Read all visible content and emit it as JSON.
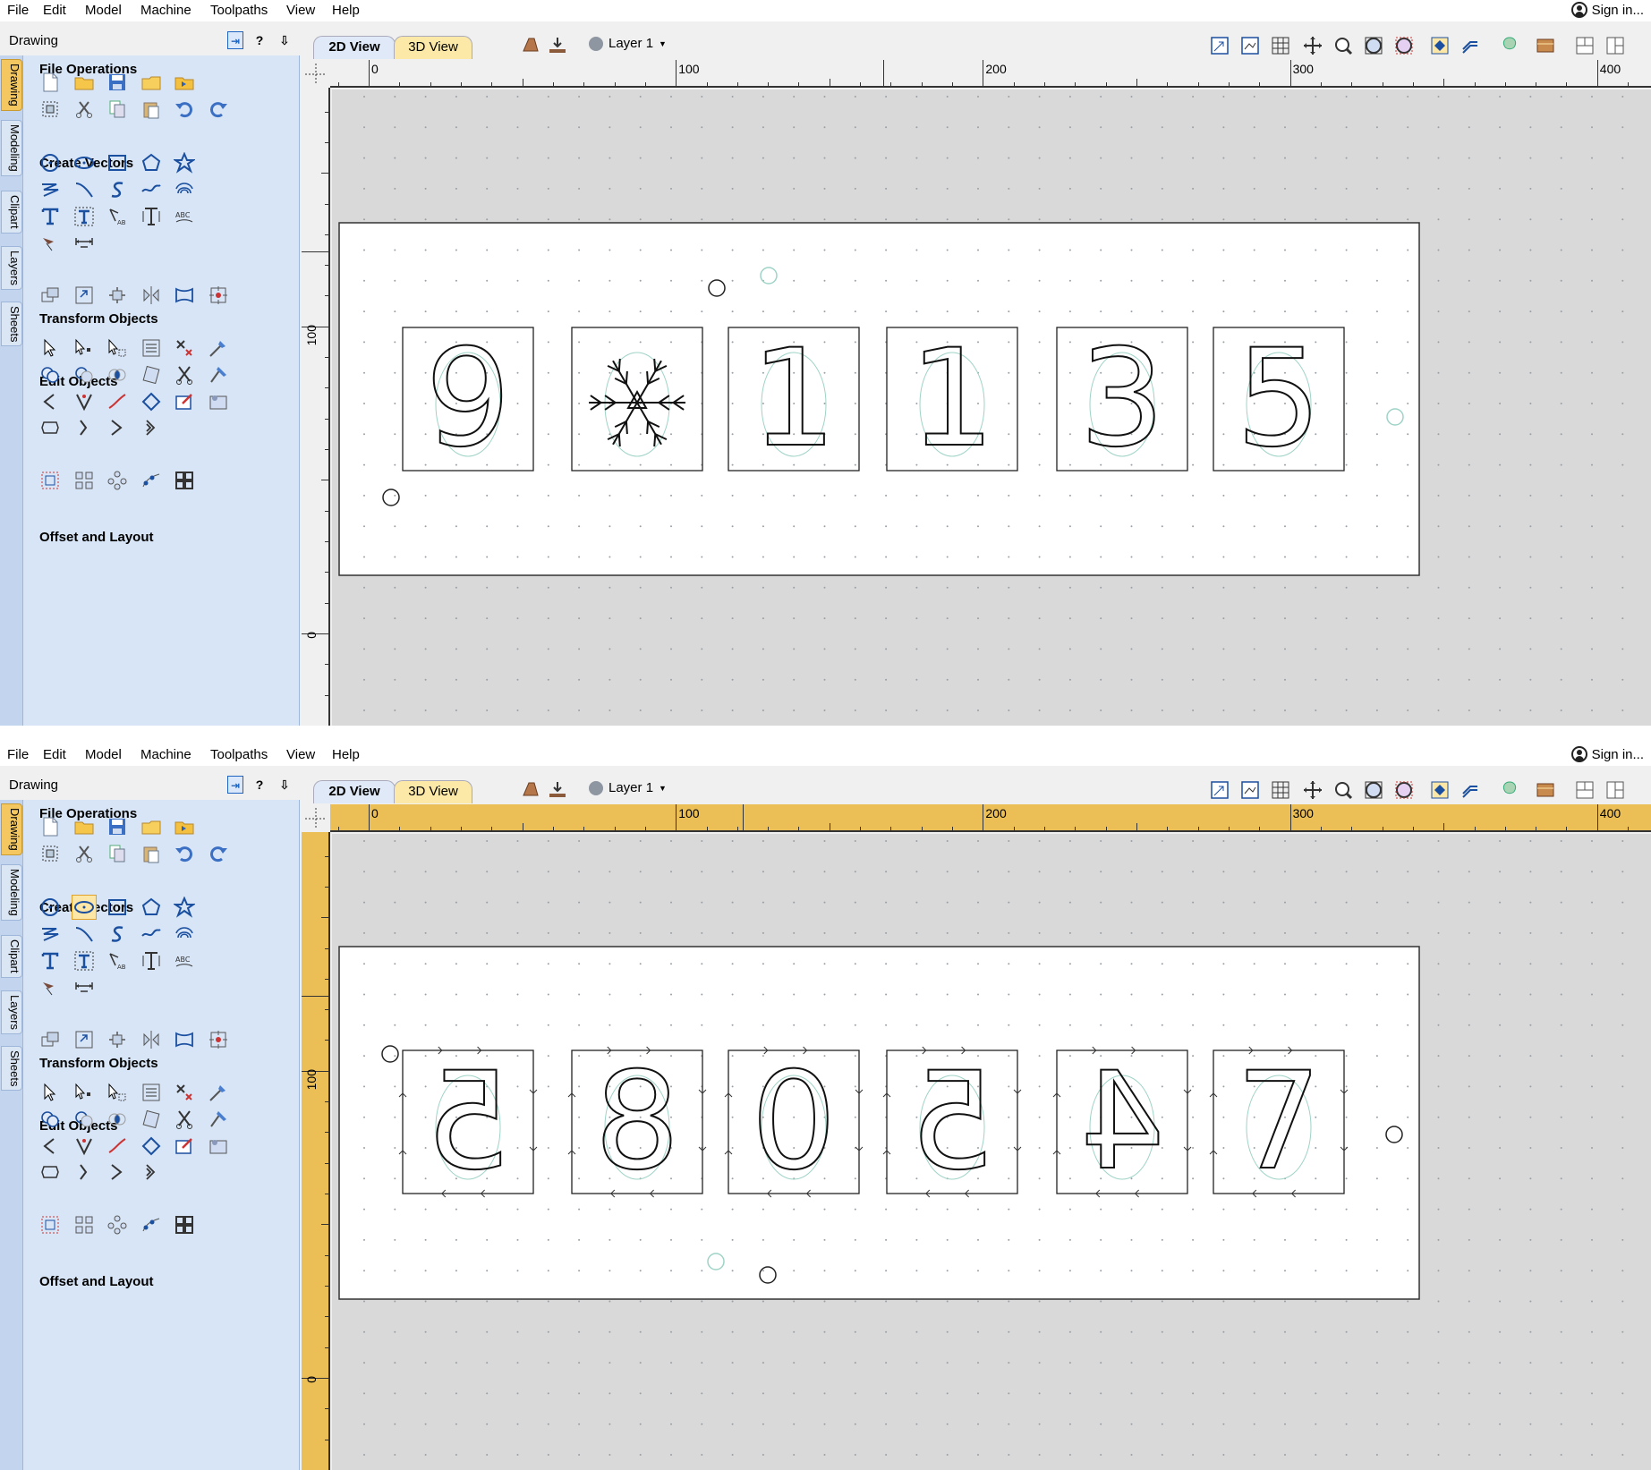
{
  "menu": [
    "File",
    "Edit",
    "Model",
    "Machine",
    "Toolpaths",
    "View",
    "Help"
  ],
  "signin": "Sign in...",
  "panel": {
    "title": "Drawing",
    "pin_symbol": "⇥",
    "help_symbol": "?",
    "close_symbol": "⇩",
    "vtabs": [
      "Drawing",
      "Modeling",
      "Clipart",
      "Layers",
      "Sheets"
    ],
    "groups": {
      "file_operations": "File Operations",
      "create_vectors": "Create Vectors",
      "transform_objects": "Transform Objects",
      "edit_objects": "Edit Objects",
      "offset_and_layout": "Offset and Layout"
    }
  },
  "view_tabs": {
    "two_d": "2D View",
    "three_d": "3D View"
  },
  "layer": "Layer 1",
  "ruler": {
    "h_labels": [
      "0",
      "100",
      "200",
      "300",
      "400"
    ],
    "v_labels": [
      "100",
      "0"
    ]
  },
  "colors": {
    "panel_bg": "#d7e5f6",
    "active_tab": "#f5c761",
    "ruler_active": "#ebbf55",
    "outline": "#111111",
    "toolpath_ghost": "#9fd3c7"
  },
  "panes": [
    {
      "id": "top",
      "characters": [
        "9",
        "❄",
        "1",
        "1",
        "3",
        "5"
      ],
      "ruler_highlight": false,
      "selected_tool": "none"
    },
    {
      "id": "bottom",
      "characters": [
        "5",
        "8",
        "0",
        "5",
        "4",
        "7"
      ],
      "ruler_highlight": true,
      "selected_tool": "draw-ellipse"
    }
  ]
}
